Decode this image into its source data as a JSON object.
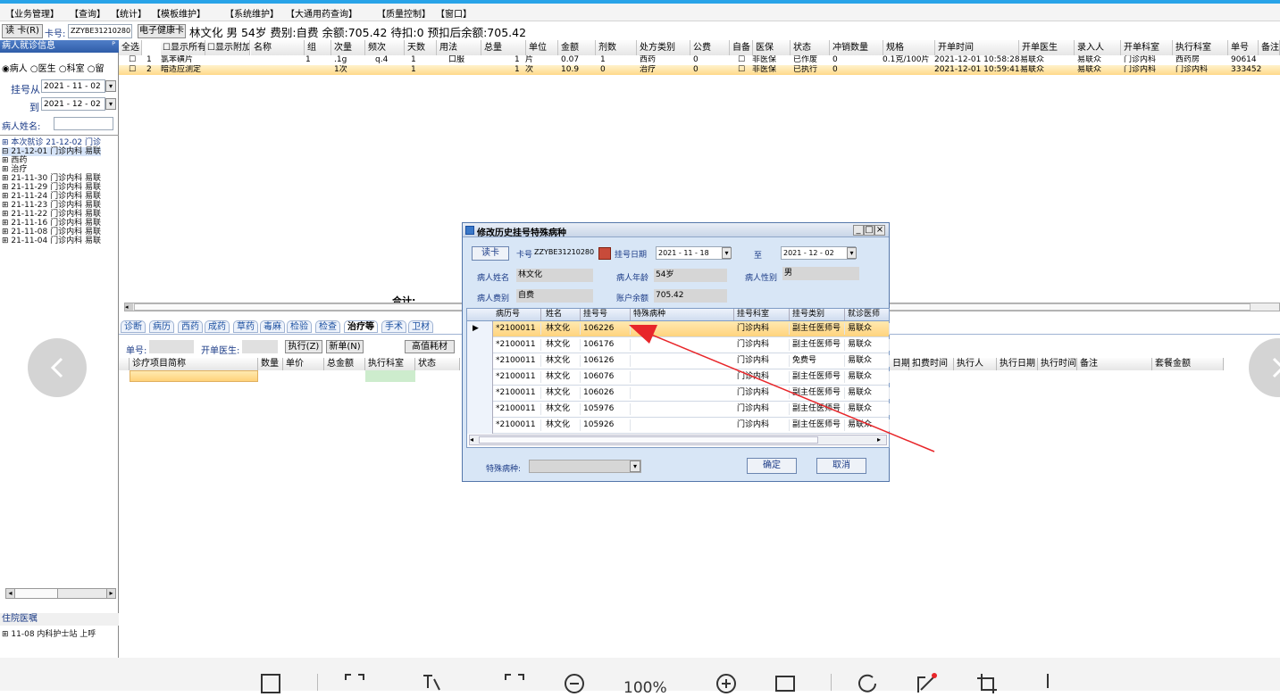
{
  "menu": [
    "【业务管理】",
    "【查询】",
    "【统计】",
    "【模板维护】",
    "【系统维护】",
    "【大通用药查询】",
    "【质量控制】",
    "【窗口】"
  ],
  "infobar": {
    "read_card": "读 卡(R)",
    "card_label": "卡号:",
    "card_no": "ZZYBE31210280",
    "health_card": "电子健康卡",
    "patient_summary": "林文化 男 54岁 费别:自费 余额:705.42 待扣:0 预扣后余额:705.42"
  },
  "left": {
    "panel_title": "病人就诊信息",
    "pin": "ᴾ",
    "radios": [
      "病人",
      "医生",
      "科室",
      "留"
    ],
    "reg_from_label": "挂号从",
    "reg_from": "2021 - 11 - 02",
    "reg_to_label": "到",
    "reg_to": "2021 - 12 - 02",
    "name_label": "病人姓名:",
    "tree": [
      "⊞ 本次就诊 21-12-02 门诊",
      "⊟ 21-12-01 门诊内科 易联",
      "   ⊞ 西药",
      "   ⊞ 治疗",
      "⊞ 21-11-30 门诊内科 易联",
      "⊞ 21-11-29 门诊内科 易联",
      "⊞ 21-11-24 门诊内科 易联",
      "⊞ 21-11-23 门诊内科 易联",
      "⊞ 21-11-22 门诊内科 易联",
      "⊞ 21-11-16 门诊内科 易联",
      "⊞ 21-11-08 门诊内科 易联",
      "⊞ 21-11-04 门诊内科 易联"
    ],
    "inpatient_title": "住院医嘱",
    "inpatient_item": "⊞ 11-08 内科护士站 上呼"
  },
  "grid": {
    "headers": [
      "全选",
      "显示所有",
      "显示附加",
      "名称",
      "组",
      "次量",
      "频次",
      "天数",
      "用法",
      "总量",
      "单位",
      "金额",
      "剂数",
      "处方类别",
      "公费",
      "自备",
      "医保",
      "状态",
      "冲销数量",
      "规格",
      "开单时间",
      "开单医生",
      "录入人",
      "开单科室",
      "执行科室",
      "单号",
      "备注"
    ],
    "rows": [
      [
        "1",
        "氯苯磺片",
        "1",
        ".1g",
        "q.4",
        "1",
        "口服",
        "1",
        "片",
        "0.07",
        "1",
        "西药",
        "0",
        "",
        "非医保",
        "已作废",
        "0",
        "0.1克/100片",
        "2021-12-01 10:58:28",
        "易联众",
        "易联众",
        "门诊内科",
        "西药房",
        "90614"
      ],
      [
        "2",
        "暗适应测定",
        "",
        "1次",
        "",
        "1",
        "",
        "1",
        "次",
        "10.9",
        "0",
        "治疗",
        "0",
        "",
        "非医保",
        "已执行",
        "0",
        "",
        "2021-12-01 10:59:41",
        "易联众",
        "易联众",
        "门诊内科",
        "门诊内科",
        "333452"
      ]
    ],
    "total_label": "合计:"
  },
  "bottom": {
    "tabs": [
      "诊断",
      "病历",
      "西药",
      "成药",
      "草药",
      "毒麻",
      "检验",
      "检查",
      "治疗等",
      "手术",
      "卫材"
    ],
    "order_no_label": "单号:",
    "doctor_label": "开单医生:",
    "exec_button": "执行(Z)",
    "new_button": "新单(N)",
    "hv_button": "高值耗材",
    "headers": [
      "诊疗项目简称",
      "数量",
      "单价",
      "总金额",
      "执行科室",
      "状态"
    ],
    "right_headers": [
      "日期",
      "扣费时间",
      "执行人",
      "执行日期",
      "执行时间",
      "备注",
      "套餐金额"
    ]
  },
  "dialog": {
    "title": "修改历史挂号特殊病种",
    "read_card": "读卡",
    "card_label": "卡号",
    "card_no": "ZZYBE31210280",
    "reg_date_label": "挂号日期",
    "date_from": "2021 - 11 - 18",
    "to_label": "至",
    "date_to": "2021 - 12 - 02",
    "name_label": "病人姓名",
    "name": "林文化",
    "age_label": "病人年龄",
    "age": "54岁",
    "sex_label": "病人性别",
    "sex": "男",
    "fee_label": "病人费别",
    "fee": "自费",
    "balance_label": "账户余额",
    "balance": "705.42",
    "columns": [
      "病历号",
      "姓名",
      "挂号号",
      "特殊病种",
      "挂号科室",
      "挂号类别",
      "就诊医师"
    ],
    "rows": [
      [
        "*2100011",
        "林文化",
        "106226",
        "",
        "门诊内科",
        "副主任医师号",
        "易联众"
      ],
      [
        "*2100011",
        "林文化",
        "106176",
        "",
        "门诊内科",
        "副主任医师号",
        "易联众"
      ],
      [
        "*2100011",
        "林文化",
        "106126",
        "",
        "门诊内科",
        "免费号",
        "易联众"
      ],
      [
        "*2100011",
        "林文化",
        "106076",
        "",
        "门诊内科",
        "副主任医师号",
        "易联众"
      ],
      [
        "*2100011",
        "林文化",
        "106026",
        "",
        "门诊内科",
        "副主任医师号",
        "易联众"
      ],
      [
        "*2100011",
        "林文化",
        "105976",
        "",
        "门诊内科",
        "副主任医师号",
        "易联众"
      ],
      [
        "*2100011",
        "林文化",
        "105926",
        "",
        "门诊内科",
        "副主任医师号",
        "易联众"
      ]
    ],
    "special_label": "特殊病种:",
    "ok": "确定",
    "cancel": "取消"
  },
  "viewer": {
    "zoom": "100%"
  },
  "colors": {
    "accent_blue": "#28a3e8",
    "arrow_red": "#e8262a",
    "selected_row": "#ffd98a"
  }
}
